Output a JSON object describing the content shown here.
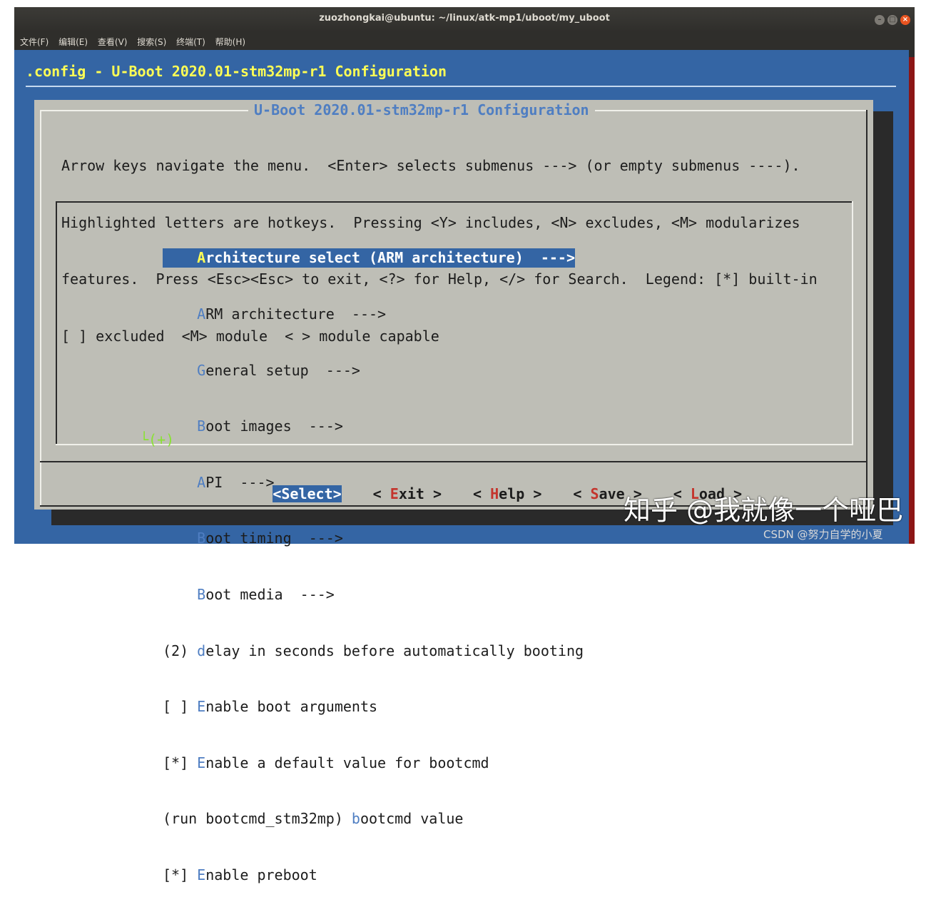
{
  "window": {
    "title": "zuozhongkai@ubuntu: ~/linux/atk-mp1/uboot/my_uboot",
    "menu": [
      "文件(F)",
      "编辑(E)",
      "查看(V)",
      "搜索(S)",
      "终端(T)",
      "帮助(H)"
    ]
  },
  "terminal": {
    "config_title": ".config - U-Boot 2020.01-stm32mp-r1 Configuration",
    "dialog_title": "U-Boot 2020.01-stm32mp-r1 Configuration",
    "help_lines": [
      "Arrow keys navigate the menu.  <Enter> selects submenus ---> (or empty submenus ----).",
      "Highlighted letters are hotkeys.  Pressing <Y> includes, <N> excludes, <M> modularizes",
      "features.  Press <Esc><Esc> to exit, <?> for Help, </> for Search.  Legend: [*] built-in",
      "[ ] excluded  <M> module  < > module capable"
    ],
    "items": [
      {
        "prefix": "    ",
        "hotkey": "A",
        "rest": "rchitecture select (ARM architecture)  --->",
        "selected": true
      },
      {
        "prefix": "    ",
        "hotkey": "A",
        "rest": "RM architecture  --->",
        "selected": false
      },
      {
        "prefix": "    ",
        "hotkey": "G",
        "rest": "eneral setup  --->",
        "selected": false
      },
      {
        "prefix": "    ",
        "hotkey": "B",
        "rest": "oot images  --->",
        "selected": false
      },
      {
        "prefix": "    ",
        "hotkey": "A",
        "rest": "PI  --->",
        "selected": false
      },
      {
        "prefix": "    ",
        "hotkey": "B",
        "rest": "oot timing  --->",
        "selected": false
      },
      {
        "prefix": "    ",
        "hotkey": "B",
        "rest": "oot media  --->",
        "selected": false
      },
      {
        "prefix": "(2) ",
        "hotkey": "d",
        "rest": "elay in seconds before automatically booting",
        "selected": false
      },
      {
        "prefix": "[ ] ",
        "hotkey": "E",
        "rest": "nable boot arguments",
        "selected": false
      },
      {
        "prefix": "[*] ",
        "hotkey": "E",
        "rest": "nable a default value for bootcmd",
        "selected": false
      },
      {
        "prefix": "(run bootcmd_stm32mp) ",
        "hotkey": "b",
        "rest": "ootcmd value",
        "selected": false
      },
      {
        "prefix": "[*] ",
        "hotkey": "E",
        "rest": "nable preboot",
        "selected": false
      }
    ],
    "more_indicator": "└(+)",
    "buttons": [
      {
        "pre": "<",
        "hotkey": "S",
        "rest": "elect>",
        "selected": true
      },
      {
        "pre": "< ",
        "hotkey": "E",
        "rest": "xit >",
        "selected": false
      },
      {
        "pre": "< ",
        "hotkey": "H",
        "rest": "elp >",
        "selected": false
      },
      {
        "pre": "< ",
        "hotkey": "S",
        "rest": "ave >",
        "selected": false
      },
      {
        "pre": "< ",
        "hotkey": "L",
        "rest": "oad >",
        "selected": false
      }
    ]
  },
  "watermarks": {
    "zhihu": "知乎 @我就像一个哑巴",
    "csdn": "CSDN @努力自学的小夏"
  },
  "colors": {
    "terminal_bg": "#3465a4",
    "dialog_bg": "#bebeb6",
    "hotkey_blue": "#4f7ec2",
    "hotkey_yellow": "#ffff55",
    "button_hotkey_red": "#c4342c",
    "more_green": "#8ae234"
  }
}
